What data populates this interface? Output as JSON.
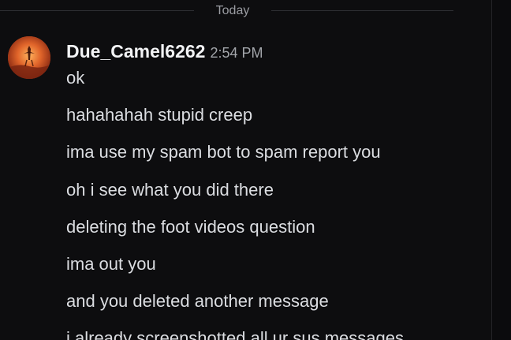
{
  "date_divider": {
    "label": "Today"
  },
  "message_group": {
    "author": "Due_Camel6262",
    "time": "2:54 PM",
    "messages": [
      "ok",
      "hahahahah stupid creep",
      "ima use my spam bot to spam report you",
      "oh i see what you did there",
      "deleting the foot videos question",
      "ima out you",
      "and you deleted another message",
      "i already screenshotted all ur sus messages"
    ]
  },
  "colors": {
    "background": "#0d0d0f",
    "username": "#f2f3f5",
    "message_text": "#dbdde1",
    "timestamp": "#a3a6ab",
    "divider": "#2e2f33"
  },
  "icons": {
    "avatar": "user-avatar-orange-desert"
  }
}
